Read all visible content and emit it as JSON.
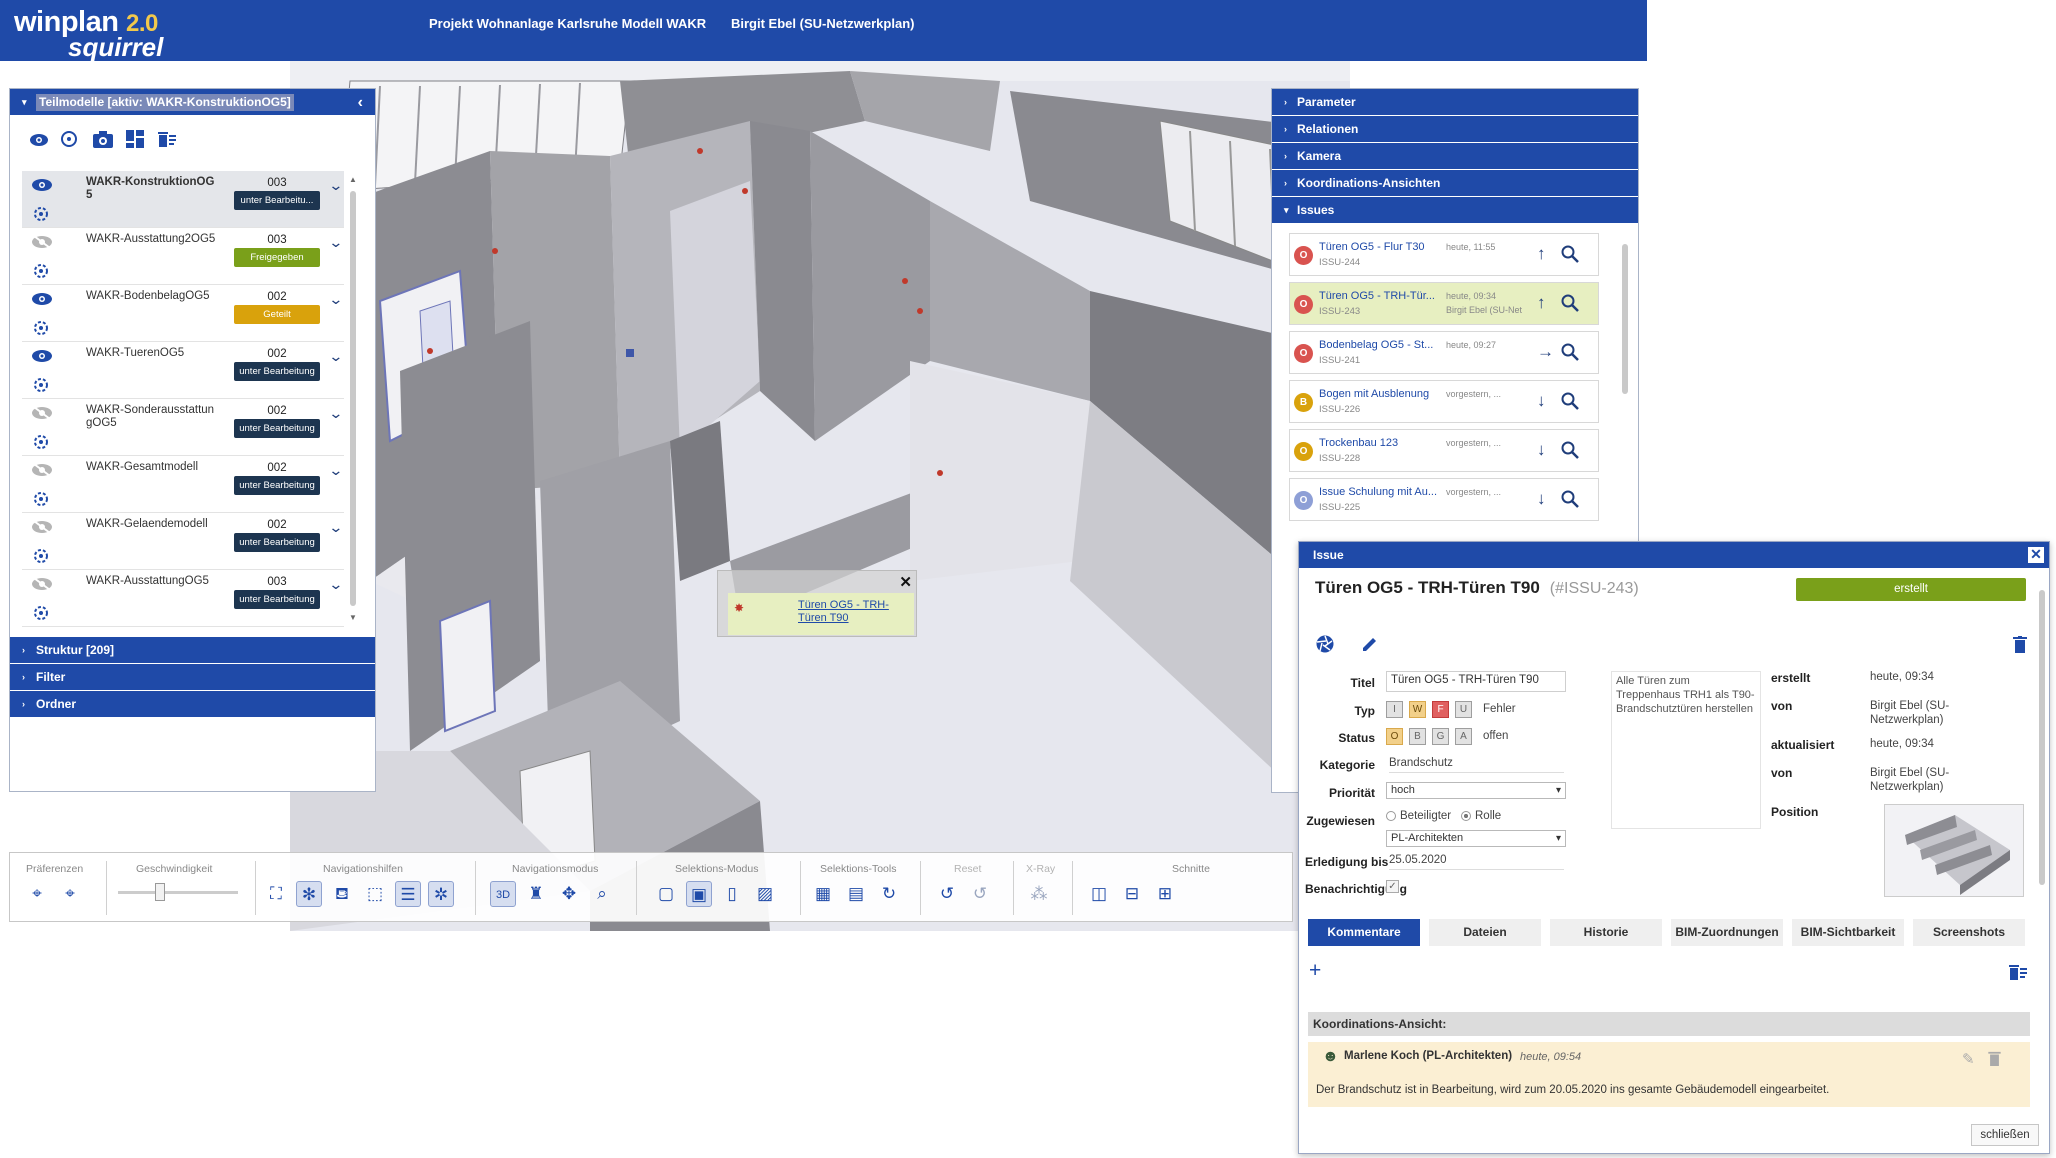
{
  "header": {
    "logo_main": "winplan",
    "logo_version": "2.0",
    "logo_sub": "squirrel",
    "project": "Projekt Wohnanlage Karlsruhe Modell WAKR",
    "user": "Birgit Ebel (SU-Netzwerkplan)"
  },
  "left_panel": {
    "title": "Teilmodelle [aktiv: WAKR-KonstruktionOG5]",
    "models": [
      {
        "name": "WAKR-KonstruktionOG5",
        "version": "003",
        "status": "unter Bearbeitu...",
        "status_color": "#1d3550",
        "visible": true
      },
      {
        "name": "WAKR-Ausstattung2OG5",
        "version": "003",
        "status": "Freigegeben",
        "status_color": "#7aa01a",
        "visible": false
      },
      {
        "name": "WAKR-BodenbelagOG5",
        "version": "002",
        "status": "Geteilt",
        "status_color": "#d9a20c",
        "visible": true
      },
      {
        "name": "WAKR-TuerenOG5",
        "version": "002",
        "status": "unter Bearbeitung",
        "status_color": "#1d3550",
        "visible": true
      },
      {
        "name": "WAKR-SonderausstattungOG5",
        "version": "002",
        "status": "unter Bearbeitung",
        "status_color": "#1d3550",
        "visible": false
      },
      {
        "name": "WAKR-Gesamtmodell",
        "version": "002",
        "status": "unter Bearbeitung",
        "status_color": "#1d3550",
        "visible": false
      },
      {
        "name": "WAKR-Gelaendemodell",
        "version": "002",
        "status": "unter Bearbeitung",
        "status_color": "#1d3550",
        "visible": false
      },
      {
        "name": "WAKR-AusstattungOG5",
        "version": "003",
        "status": "unter Bearbeitung",
        "status_color": "#1d3550",
        "visible": false
      }
    ],
    "sections": [
      "Struktur [209]",
      "Filter",
      "Ordner"
    ]
  },
  "toolbar": {
    "groups": [
      "Präferenzen",
      "Geschwindigkeit",
      "Navigationshilfen",
      "Navigationsmodus",
      "Selektions-Modus",
      "Selektions-Tools",
      "Reset",
      "X-Ray",
      "Schnitte"
    ]
  },
  "tooltip": {
    "text": "Türen OG5 - TRH-Türen T90"
  },
  "right_panel": {
    "sections": [
      "Parameter",
      "Relationen",
      "Kamera",
      "Koordinations-Ansichten",
      "Issues"
    ],
    "issues": [
      {
        "badge": "O",
        "color": "#d9534f",
        "title": "Türen OG5 - Flur T30",
        "id": "ISSU-244",
        "date": "heute, 11:55",
        "by": "",
        "arrow": "↑",
        "selected": false
      },
      {
        "badge": "O",
        "color": "#d9534f",
        "title": "Türen OG5 - TRH-Tür...",
        "id": "ISSU-243",
        "date": "heute, 09:34",
        "by": "Birgit Ebel (SU-Net",
        "arrow": "↑",
        "selected": true
      },
      {
        "badge": "O",
        "color": "#d9534f",
        "title": "Bodenbelag OG5 - St...",
        "id": "ISSU-241",
        "date": "heute, 09:27",
        "by": "",
        "arrow": "→",
        "selected": false
      },
      {
        "badge": "B",
        "color": "#d9a20c",
        "title": "Bogen mit Ausblenung",
        "id": "ISSU-226",
        "date": "vorgestern, ...",
        "by": "",
        "arrow": "↓",
        "selected": false
      },
      {
        "badge": "O",
        "color": "#d9a20c",
        "title": "Trockenbau 123",
        "id": "ISSU-228",
        "date": "vorgestern, ...",
        "by": "",
        "arrow": "↓",
        "selected": false
      },
      {
        "badge": "O",
        "color": "#8e9fd6",
        "title": "Issue Schulung mit Au...",
        "id": "ISSU-225",
        "date": "vorgestern, ...",
        "by": "",
        "arrow": "↓",
        "selected": false
      }
    ]
  },
  "dialog": {
    "header": "Issue",
    "title": "Türen OG5 - TRH-Türen T90",
    "id": "(#ISSU-243)",
    "status": "erstellt",
    "labels": {
      "titel": "Titel",
      "typ": "Typ",
      "status": "Status",
      "kategorie": "Kategorie",
      "prioritaet": "Priorität",
      "zugewiesen": "Zugewiesen",
      "erledigung": "Erledigung bis",
      "benachrichtigung": "Benachrichtigung",
      "erstellt": "erstellt",
      "von": "von",
      "aktualisiert": "aktualisiert",
      "position": "Position"
    },
    "titel_value": "Türen OG5 - TRH-Türen T90",
    "typ_chips": [
      "I",
      "W",
      "F",
      "U"
    ],
    "typ_value": "Fehler",
    "status_chips": [
      "O",
      "B",
      "G",
      "A"
    ],
    "status_value": "offen",
    "kategorie_value": "Brandschutz",
    "prioritaet_value": "hoch",
    "zugewiesen_opt1": "Beteiligter",
    "zugewiesen_opt2": "Rolle",
    "zugewiesen_value": "PL-Architekten",
    "erledigung_value": "25.05.2020",
    "description": "Alle Türen zum Treppenhaus TRH1 als T90-Brandschutztüren herstellen",
    "erstellt_value": "heute, 09:34",
    "erstellt_von": "Birgit Ebel (SU-Netzwerkplan)",
    "aktualisiert_value": "heute, 09:34",
    "aktualisiert_von": "Birgit Ebel (SU-Netzwerkplan)",
    "tabs": [
      "Kommentare",
      "Dateien",
      "Historie",
      "BIM-Zuordnungen",
      "BIM-Sichtbarkeit",
      "Screenshots"
    ],
    "koord_label": "Koordinations-Ansicht:",
    "comment_author": "Marlene Koch (PL-Architekten)",
    "comment_time": "heute, 09:54",
    "comment_text": "Der Brandschutz ist in Bearbeitung, wird zum 20.05.2020 ins gesamte Gebäudemodell eingearbeitet.",
    "close_button": "schließen"
  }
}
